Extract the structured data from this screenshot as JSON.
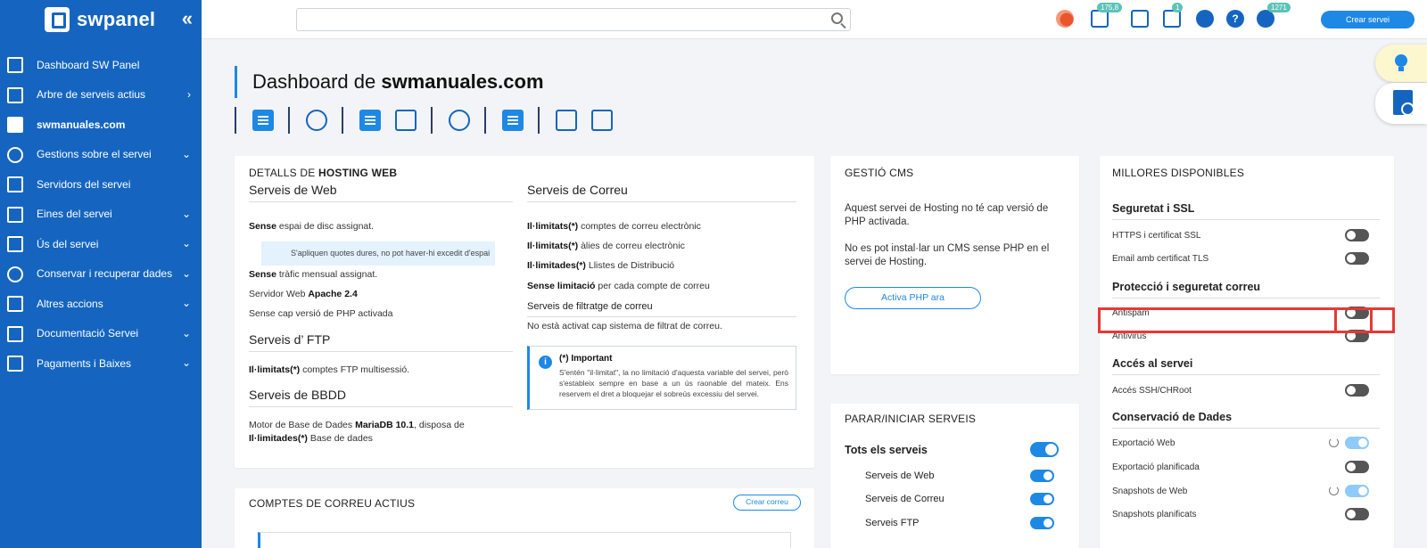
{
  "sidebar": {
    "logo": "swpanel",
    "items": [
      {
        "label": "Dashboard SW Panel",
        "chevron": ""
      },
      {
        "label": "Arbre de serveis actius",
        "chevron": "›"
      },
      {
        "label": "swmanuales.com",
        "chevron": ""
      },
      {
        "label": "Gestions sobre el servei",
        "chevron": "⌄"
      },
      {
        "label": "Servidors del servei",
        "chevron": ""
      },
      {
        "label": "Eines del servei",
        "chevron": "⌄"
      },
      {
        "label": "Ús del servei",
        "chevron": "⌄"
      },
      {
        "label": "Conservar i recuperar dades",
        "chevron": "⌄"
      },
      {
        "label": "Altres accions",
        "chevron": "⌄"
      },
      {
        "label": "Documentació Servei",
        "chevron": "⌄"
      },
      {
        "label": "Pagaments i Baixes",
        "chevron": "⌄"
      }
    ]
  },
  "topbar": {
    "search_placeholder": "",
    "badges": {
      "wallet": "175,8",
      "notes": "1",
      "user": "1271"
    },
    "help": "?",
    "create_button": "Crear servei"
  },
  "header": {
    "title_prefix": "Dashboard de ",
    "title_domain": "swmanuales.com"
  },
  "hosting": {
    "title_prefix": "DETALLS DE ",
    "title_bold": "HOSTING WEB",
    "web": {
      "heading": "Serveis de Web",
      "disk_bold": "Sense",
      "disk_rest": " espai de disc assignat.",
      "note": "S'apliquen quotes dures, no pot haver-hi excedit d'espai",
      "traffic_bold": "Sense",
      "traffic_rest": " tràfic mensual assignat.",
      "server_prefix": "Servidor Web ",
      "server_bold": "Apache 2.4",
      "php": "Sense cap versió de PHP activada"
    },
    "ftp": {
      "heading": "Serveis d’ FTP",
      "line_bold": "Il·limitats(*)",
      "line_rest": " comptes FTP multisessió."
    },
    "bbdd": {
      "heading": "Serveis de BBDD",
      "line1_prefix": "Motor de Base de Dades ",
      "line1_bold": "MariaDB 10.1",
      "line1_rest": ", disposa de",
      "line2_bold": "Il·limitades(*)",
      "line2_rest": " Base de dades"
    },
    "mail": {
      "heading": "Serveis de Correu",
      "l1_bold": "Il·limitats(*)",
      "l1_rest": " comptes de correu electrònic",
      "l2_bold": "Il·limitats(*)",
      "l2_rest": " àlies de correu electrònic",
      "l3_bold": "Il·limitades(*)",
      "l3_rest": " Llistes de Distribució",
      "l4_bold": "Sense limitació",
      "l4_rest": " per cada compte de correu",
      "filter_heading": "Serveis de filtratge de correu",
      "filter_line": "No està activat cap sistema de filtrat de correu."
    },
    "important": {
      "icon": "i",
      "title": "(*) Important",
      "text": "S'entén \"il·limitat\", la no limitació d'aquesta variable del servei, però s'estableix sempre en base a un ús raonable del mateix. Ens reservem el dret a bloquejar el sobreús excessiu del servei."
    }
  },
  "cms": {
    "title": "GESTIÓ CMS",
    "p1": "Aquest servei de Hosting no té cap versió de PHP activada.",
    "p2": "No es pot instal·lar un CMS sense PHP en el servei de Hosting.",
    "button": "Activa PHP ara"
  },
  "parar": {
    "title": "PARAR/INICIAR SERVEIS",
    "all": "Tots els serveis",
    "items": [
      "Serveis de Web",
      "Serveis de Correu",
      "Serveis FTP"
    ]
  },
  "millores": {
    "title": "MILLORES DISPONIBLES",
    "sections": [
      {
        "heading": "Seguretat i SSL",
        "items": [
          {
            "label": "HTTPS i certificat SSL",
            "state": "off"
          },
          {
            "label": "Email amb certificat TLS",
            "state": "off"
          }
        ]
      },
      {
        "heading": "Protecció i seguretat correu",
        "items": [
          {
            "label": "Antispam",
            "state": "off"
          },
          {
            "label": "Antivirus",
            "state": "off"
          }
        ]
      },
      {
        "heading": "Accés al servei",
        "items": [
          {
            "label": "Accés SSH/CHRoot",
            "state": "off"
          }
        ]
      },
      {
        "heading": "Conservació de Dades",
        "items": [
          {
            "label": "Exportació Web",
            "state": "pending"
          },
          {
            "label": "Exportació planificada",
            "state": "off"
          },
          {
            "label": "Snapshots de Web",
            "state": "pending"
          },
          {
            "label": "Snapshots planificats",
            "state": "off"
          }
        ]
      }
    ]
  },
  "comptes": {
    "title": "COMPTES DE CORREU ACTIUS",
    "button": "Crear correu"
  }
}
